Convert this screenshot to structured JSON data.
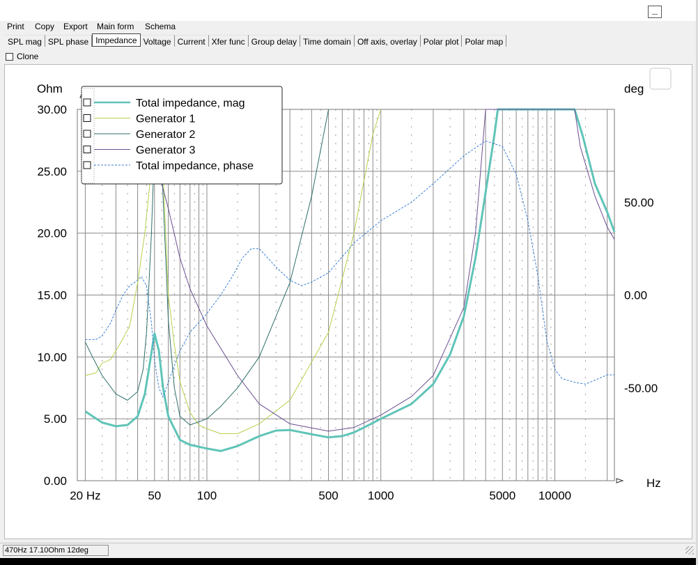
{
  "window": {
    "minimize_glyph": "_"
  },
  "menu": [
    "Print",
    "Copy",
    "Export",
    "Main form",
    "Schema"
  ],
  "tabs": [
    {
      "label": "SPL mag",
      "active": false
    },
    {
      "label": "SPL phase",
      "active": false
    },
    {
      "label": "Impedance",
      "active": true
    },
    {
      "label": "Voltage",
      "active": false
    },
    {
      "label": "Current",
      "active": false
    },
    {
      "label": "Xfer func",
      "active": false
    },
    {
      "label": "Group delay",
      "active": false
    },
    {
      "label": "Time domain",
      "active": false
    },
    {
      "label": "Off axis, overlay",
      "active": false
    },
    {
      "label": "Polar plot",
      "active": false
    },
    {
      "label": "Polar map",
      "active": false
    }
  ],
  "clone": {
    "label": "Clone",
    "checked": false
  },
  "status": {
    "readout": "470Hz 17.10Ohm  12deg"
  },
  "chart_data": {
    "type": "line",
    "x_scale": "log",
    "xlim": [
      18,
      22000
    ],
    "ylim": [
      0,
      30
    ],
    "y2lim": [
      -100,
      100
    ],
    "ylabel": "Ohm",
    "y2label": "deg",
    "xlabel": "Hz",
    "x_ticks": [
      {
        "value": 20,
        "label": "20 Hz"
      },
      {
        "value": 50,
        "label": "50"
      },
      {
        "value": 100,
        "label": "100"
      },
      {
        "value": 500,
        "label": "500"
      },
      {
        "value": 1000,
        "label": "1000"
      },
      {
        "value": 5000,
        "label": "5000"
      },
      {
        "value": 10000,
        "label": "10000"
      }
    ],
    "y_ticks": [
      {
        "value": 0,
        "label": "0.00"
      },
      {
        "value": 5,
        "label": "5.00"
      },
      {
        "value": 10,
        "label": "10.00"
      },
      {
        "value": 15,
        "label": "15.00"
      },
      {
        "value": 20,
        "label": "20.00"
      },
      {
        "value": 25,
        "label": "25.00"
      },
      {
        "value": 30,
        "label": "30.00"
      }
    ],
    "y2_ticks": [
      {
        "value": 50,
        "label": "50.00"
      },
      {
        "value": 0,
        "label": "0.00"
      },
      {
        "value": -50,
        "label": "-50.00"
      }
    ],
    "grid": true,
    "legend_position": "top-left",
    "series": [
      {
        "name": "Total impedance, mag",
        "color": "#5fc4b8",
        "width": 3,
        "dash": "",
        "axis": "left",
        "points": [
          [
            20,
            5.6
          ],
          [
            25,
            4.7
          ],
          [
            30,
            4.4
          ],
          [
            35,
            4.5
          ],
          [
            40,
            5.2
          ],
          [
            44,
            7.0
          ],
          [
            47,
            9.5
          ],
          [
            50,
            11.9
          ],
          [
            53,
            10.5
          ],
          [
            56,
            7.5
          ],
          [
            60,
            5.2
          ],
          [
            70,
            3.3
          ],
          [
            80,
            2.9
          ],
          [
            100,
            2.6
          ],
          [
            120,
            2.4
          ],
          [
            150,
            2.8
          ],
          [
            200,
            3.6
          ],
          [
            250,
            4.05
          ],
          [
            300,
            4.1
          ],
          [
            400,
            3.75
          ],
          [
            500,
            3.5
          ],
          [
            600,
            3.6
          ],
          [
            700,
            3.9
          ],
          [
            800,
            4.3
          ],
          [
            1000,
            5.0
          ],
          [
            1500,
            6.2
          ],
          [
            2000,
            7.8
          ],
          [
            2500,
            10.2
          ],
          [
            3000,
            13.3
          ],
          [
            3500,
            18.0
          ],
          [
            4000,
            23.3
          ],
          [
            4500,
            28.0
          ],
          [
            4700,
            30
          ],
          [
            13000,
            30
          ],
          [
            14500,
            27.8
          ],
          [
            17000,
            24.0
          ],
          [
            20000,
            21.7
          ],
          [
            22000,
            20.1
          ]
        ]
      },
      {
        "name": "Generator 1",
        "color": "#b4d24b",
        "width": 1,
        "dash": "",
        "axis": "left",
        "points": [
          [
            20,
            8.5
          ],
          [
            23,
            8.7
          ],
          [
            25,
            9.5
          ],
          [
            28,
            9.8
          ],
          [
            30,
            10.5
          ],
          [
            33,
            11.5
          ],
          [
            36,
            12.5
          ],
          [
            40,
            16.0
          ],
          [
            44,
            20.0
          ],
          [
            47,
            24.0
          ],
          [
            50,
            28.0
          ],
          [
            52,
            30
          ],
          [
            54,
            30
          ],
          [
            56,
            25.0
          ],
          [
            60,
            15.0
          ],
          [
            65,
            11.0
          ],
          [
            70,
            8.0
          ],
          [
            80,
            5.5
          ],
          [
            90,
            4.5
          ],
          [
            100,
            4.2
          ],
          [
            120,
            3.8
          ],
          [
            150,
            3.8
          ],
          [
            200,
            4.6
          ],
          [
            300,
            6.5
          ],
          [
            500,
            12.0
          ],
          [
            700,
            20.0
          ],
          [
            900,
            28.0
          ],
          [
            1000,
            30
          ]
        ]
      },
      {
        "name": "Generator 2",
        "color": "#2c6e69",
        "width": 1,
        "dash": "",
        "axis": "left",
        "points": [
          [
            20,
            11.2
          ],
          [
            22,
            10.0
          ],
          [
            25,
            8.5
          ],
          [
            30,
            7.0
          ],
          [
            35,
            6.5
          ],
          [
            40,
            7.2
          ],
          [
            43,
            9.0
          ],
          [
            45,
            12.0
          ],
          [
            48,
            20.0
          ],
          [
            50,
            27.0
          ],
          [
            52,
            30
          ],
          [
            55,
            25.5
          ],
          [
            58,
            18.0
          ],
          [
            60,
            13.0
          ],
          [
            65,
            7.5
          ],
          [
            70,
            5.2
          ],
          [
            80,
            4.5
          ],
          [
            100,
            5.0
          ],
          [
            120,
            6.0
          ],
          [
            150,
            7.5
          ],
          [
            200,
            10.0
          ],
          [
            300,
            16.0
          ],
          [
            400,
            23.0
          ],
          [
            500,
            30
          ]
        ]
      },
      {
        "name": "Generator 3",
        "color": "#6a4c8f",
        "width": 1,
        "dash": "",
        "axis": "left",
        "points": [
          [
            50,
            29.0
          ],
          [
            52,
            26.0
          ],
          [
            55,
            24.0
          ],
          [
            60,
            22.0
          ],
          [
            70,
            18.0
          ],
          [
            80,
            15.5
          ],
          [
            100,
            12.5
          ],
          [
            150,
            8.5
          ],
          [
            200,
            6.2
          ],
          [
            300,
            4.6
          ],
          [
            500,
            4.0
          ],
          [
            700,
            4.3
          ],
          [
            1000,
            5.3
          ],
          [
            1500,
            6.8
          ],
          [
            2000,
            8.5
          ],
          [
            3000,
            14.0
          ],
          [
            3500,
            20.0
          ],
          [
            4000,
            30
          ],
          [
            13000,
            30
          ],
          [
            14000,
            27.0
          ],
          [
            17000,
            23.0
          ],
          [
            20000,
            20.5
          ],
          [
            22000,
            19.5
          ]
        ]
      },
      {
        "name": "Total impedance, phase",
        "color": "#3a7fd0",
        "width": 1,
        "dash": "3,2",
        "axis": "right",
        "points": [
          [
            20,
            -24
          ],
          [
            23,
            -24
          ],
          [
            25,
            -22
          ],
          [
            28,
            -15
          ],
          [
            30,
            -8
          ],
          [
            33,
            0
          ],
          [
            36,
            5
          ],
          [
            40,
            8
          ],
          [
            42,
            10
          ],
          [
            45,
            5
          ],
          [
            48,
            -15
          ],
          [
            50,
            -35
          ],
          [
            53,
            -50
          ],
          [
            56,
            -55
          ],
          [
            60,
            -47
          ],
          [
            65,
            -38
          ],
          [
            70,
            -30
          ],
          [
            80,
            -20
          ],
          [
            100,
            -10
          ],
          [
            120,
            0
          ],
          [
            140,
            10
          ],
          [
            160,
            20
          ],
          [
            180,
            25
          ],
          [
            200,
            25
          ],
          [
            250,
            15
          ],
          [
            300,
            8
          ],
          [
            350,
            5
          ],
          [
            400,
            7
          ],
          [
            500,
            12
          ],
          [
            700,
            28
          ],
          [
            1000,
            40
          ],
          [
            1500,
            50
          ],
          [
            2000,
            60
          ],
          [
            3000,
            75
          ],
          [
            4000,
            83
          ],
          [
            5000,
            80
          ],
          [
            6000,
            65
          ],
          [
            7000,
            40
          ],
          [
            8000,
            10
          ],
          [
            9000,
            -25
          ],
          [
            10000,
            -40
          ],
          [
            11000,
            -45
          ],
          [
            13000,
            -47
          ],
          [
            15000,
            -48
          ],
          [
            20000,
            -43
          ],
          [
            22000,
            -43
          ]
        ]
      }
    ]
  }
}
